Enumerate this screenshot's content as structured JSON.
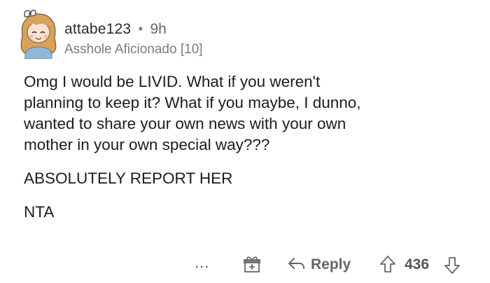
{
  "comment": {
    "author": "attabe123",
    "separator": "•",
    "time": "9h",
    "flair": "Asshole Aficionado [10]",
    "paragraphs": [
      "Omg I would be LIVID. What if you weren't\nplanning to keep it? What if you maybe, I dunno,\nwanted to share your own news with your own\nmother in your own special way???",
      "ABSOLUTELY REPORT HER",
      "NTA"
    ]
  },
  "actions": {
    "more_label": "...",
    "award_icon": "gift-award-icon",
    "reply_icon": "reply-arrow-icon",
    "reply_label": "Reply",
    "upvote_icon": "upvote-arrow-icon",
    "score": "436",
    "downvote_icon": "downvote-arrow-icon"
  },
  "colors": {
    "text": "#1c1c1c",
    "muted": "#7b7b7b",
    "avatar_hair": "#d9a15a",
    "avatar_skin": "#fbe3cf"
  }
}
